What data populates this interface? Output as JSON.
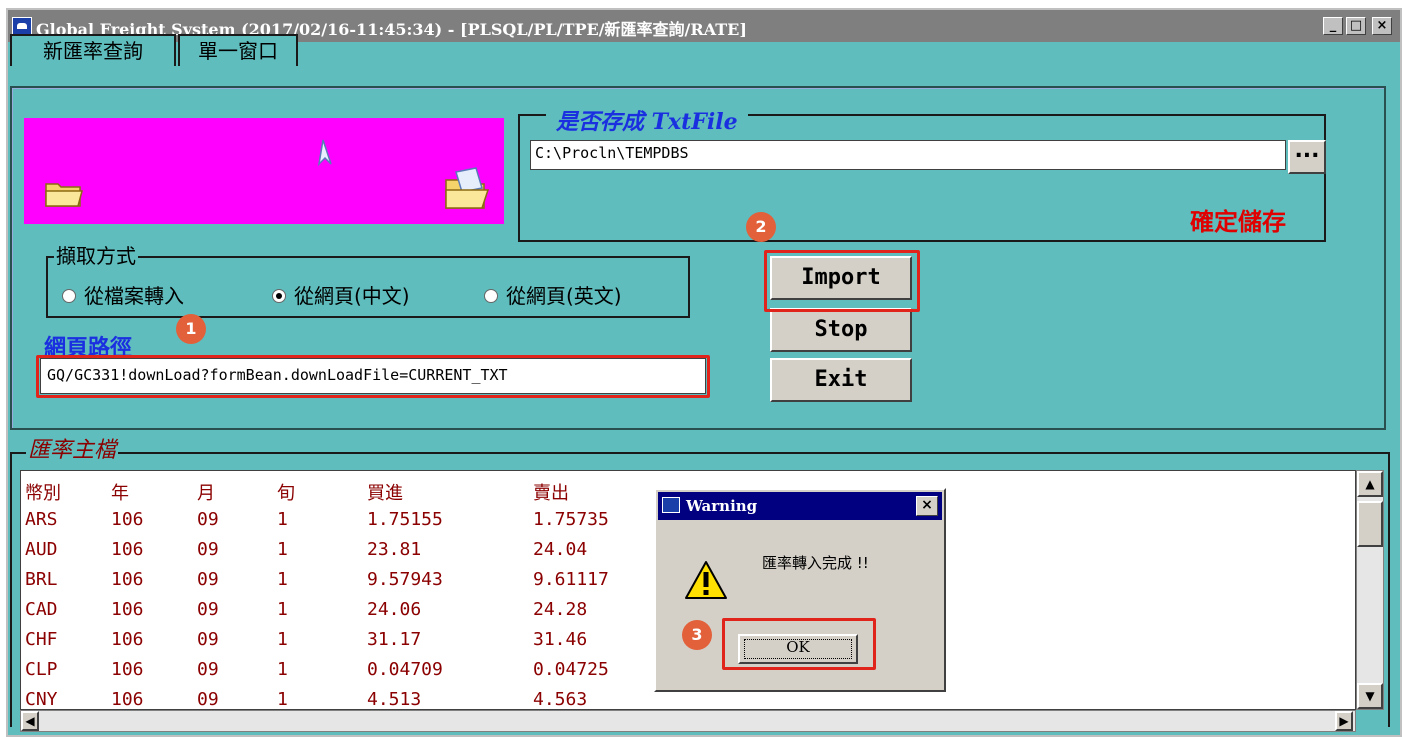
{
  "window": {
    "title": "Global Freight System (2017/02/16-11:45:34) - [PLSQL/PL/TPE/新匯率查詢/RATE]",
    "controls": {
      "minimize": "_",
      "maximize": "□",
      "close": "×"
    }
  },
  "tabs": [
    {
      "label": "新匯率查詢",
      "active": true
    },
    {
      "label": "單一窗口",
      "active": false
    }
  ],
  "txtfile": {
    "legend": "是否存成 TxtFile",
    "path_value": "C:\\Procln\\TEMPDBS",
    "browse_label": "...",
    "confirm_label": "確定儲存"
  },
  "fetch_mode": {
    "legend": "擷取方式",
    "options": [
      {
        "label": "從檔案轉入",
        "selected": false
      },
      {
        "label": "從網頁(中文)",
        "selected": true
      },
      {
        "label": "從網頁(英文)",
        "selected": false
      }
    ]
  },
  "webpath": {
    "label": "網頁路徑",
    "value": "GQ/GC331!downLoad?formBean.downLoadFile=CURRENT_TXT"
  },
  "buttons": {
    "import": "Import",
    "stop": "Stop",
    "exit": "Exit"
  },
  "steps": [
    "1",
    "2",
    "3"
  ],
  "rate_master": {
    "legend": "匯率主檔",
    "columns": [
      "幣別",
      "年",
      "月",
      "旬",
      "買進",
      "賣出"
    ],
    "rows": [
      [
        "ARS",
        "106",
        "09",
        "1",
        "1.75155",
        "1.75735"
      ],
      [
        "AUD",
        "106",
        "09",
        "1",
        "23.81",
        "24.04"
      ],
      [
        "BRL",
        "106",
        "09",
        "1",
        "9.57943",
        "9.61117"
      ],
      [
        "CAD",
        "106",
        "09",
        "1",
        "24.06",
        "24.28"
      ],
      [
        "CHF",
        "106",
        "09",
        "1",
        "31.17",
        "31.46"
      ],
      [
        "CLP",
        "106",
        "09",
        "1",
        "0.04709",
        "0.04725"
      ],
      [
        "CNY",
        "106",
        "09",
        "1",
        "4.513",
        "4.563"
      ]
    ]
  },
  "warning_dialog": {
    "title": "Warning",
    "message": "匯率轉入完成 !!",
    "ok_label": "OK",
    "close_label": "×"
  },
  "colors": {
    "window_bg": "#5fbdbd",
    "highlight": "#e0241c",
    "badge": "#e2603a",
    "legend_blue": "#1a2fe0",
    "confirm_red": "#e00000",
    "table_text": "#8b0000",
    "magenta": "#ff00ff"
  },
  "icons": [
    "app-icon",
    "folder-icon",
    "open-folder-icon",
    "cursor-icon",
    "warning-icon"
  ]
}
